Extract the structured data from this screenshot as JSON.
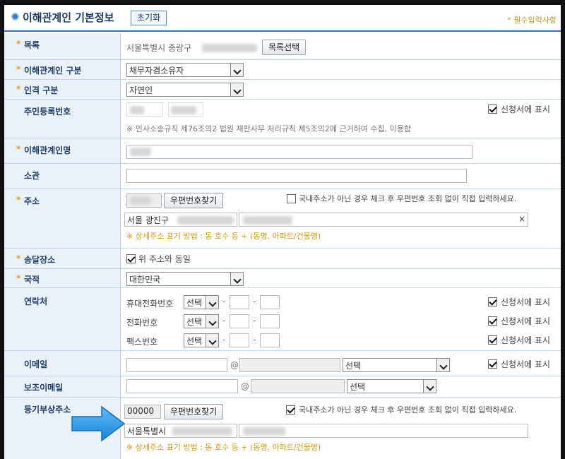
{
  "header": {
    "title": "이해관계인 기본정보",
    "reset_label": "초기화",
    "required_note": "* 필수입력사항"
  },
  "star": "*",
  "rows": {
    "catalog": {
      "label": "목록",
      "value": "서울특별시 중랑구 ",
      "button": "목록선택"
    },
    "party_type": {
      "label": "이해관계인 구분",
      "value": "채무자겸소유자"
    },
    "person_type": {
      "label": "인격 구분",
      "value": "자연인"
    },
    "rrn": {
      "label": "주민등록번호",
      "show_label": "신청서에 표시",
      "note": "※ 민사소송규칙 제76조의2 법원 재판사무 처리규칙 제5조의2에 근거하여 수집, 이용함"
    },
    "name": {
      "label": "이해관계인명"
    },
    "jurisdiction": {
      "label": "소관"
    },
    "address": {
      "label": "주소",
      "zip_button": "우편번호찾기",
      "foreign_note": "국내주소가 아닌 경우 체크 후 우편번호 조회 없이 직접 입력하세요.",
      "addr1": "서울 광진구 ",
      "clear": "×",
      "hint": "※ 상세주소 표기 방법 : 동 호수 등 + (동명, 아파트/건물명)"
    },
    "delivery": {
      "label": "송달장소",
      "same_label": "위 주소와 동일"
    },
    "nationality": {
      "label": "국적",
      "value": "대한민국"
    },
    "contact": {
      "label": "연락처",
      "show_label": "신청서에 표시",
      "select_placeholder": "선택",
      "dash": "-",
      "mobile": "휴대전화번호",
      "phone": "전화번호",
      "fax": "팩스번호"
    },
    "email": {
      "label": "이메일",
      "at": "@",
      "select": "선택",
      "show_label": "신청서에 표시"
    },
    "sub_email": {
      "label": "보조이메일",
      "at": "@",
      "select": "선택"
    },
    "reg_address": {
      "label": "등기부상주소",
      "zip": "00000",
      "zip_button": "우편번호찾기",
      "foreign_note": "국내주소가 아닌 경우 체크 후 우편번호 조회 없이 직접 입력하세요.",
      "addr1": "서울특별시 ",
      "hint": "※ 상세주소 표기 방법 : 동 호수 등 + (동명, 아파트/건물명)"
    }
  },
  "colors": {
    "label_bg": "#eaf1f9",
    "border": "#c6d6ea",
    "accent": "#3c6fb2",
    "hint": "#d49a13",
    "arrow": "#2e9be6"
  },
  "icons": {
    "arrow": "arrow-right-icon",
    "bullet": "bullet-icon"
  }
}
